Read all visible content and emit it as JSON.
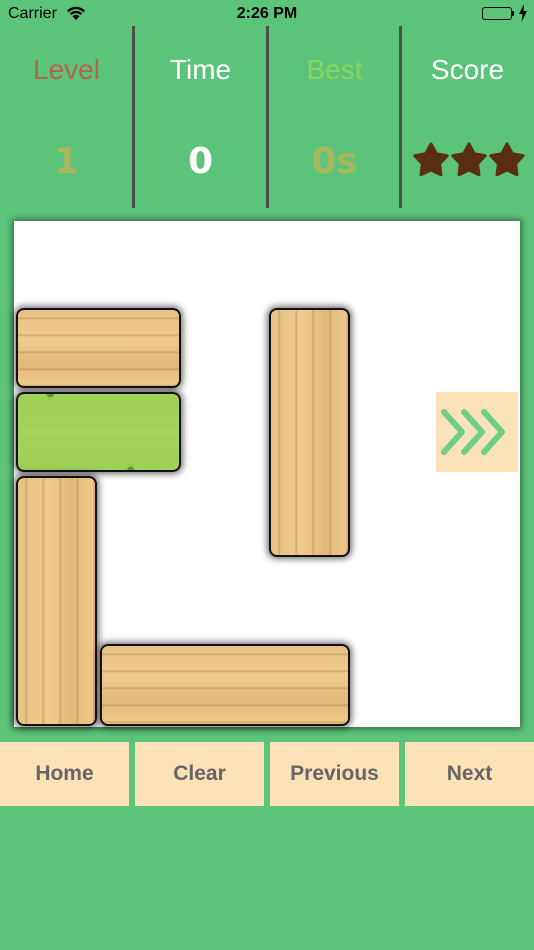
{
  "status_bar": {
    "carrier": "Carrier",
    "time": "2:26 PM"
  },
  "stats": {
    "level": {
      "label": "Level",
      "value": "1",
      "label_color": "#b5654a",
      "value_color": "#a8b85a"
    },
    "time": {
      "label": "Time",
      "value": "0",
      "label_color": "#ffffff",
      "value_color": "#ffffff"
    },
    "best": {
      "label": "Best",
      "value": "0s",
      "label_color": "#8fd45a",
      "value_color": "#a8b85a"
    },
    "score": {
      "label": "Score",
      "stars": 3,
      "star_color": "#5a2e12",
      "label_color": "#ffffff"
    }
  },
  "colors": {
    "background": "#5cc47a",
    "button_bg": "#fde2b8",
    "button_text": "#666666",
    "exit_arrow": "#6fcf84"
  },
  "board": {
    "exit_icon": "triple-chevron-right-icon",
    "blocks": [
      {
        "kind": "wood",
        "orientation": "horizontal"
      },
      {
        "kind": "grass",
        "orientation": "horizontal",
        "target": true
      },
      {
        "kind": "wood",
        "orientation": "vertical"
      },
      {
        "kind": "wood",
        "orientation": "vertical"
      },
      {
        "kind": "wood",
        "orientation": "horizontal"
      }
    ]
  },
  "buttons": {
    "home": "Home",
    "clear": "Clear",
    "previous": "Previous",
    "next": "Next"
  }
}
